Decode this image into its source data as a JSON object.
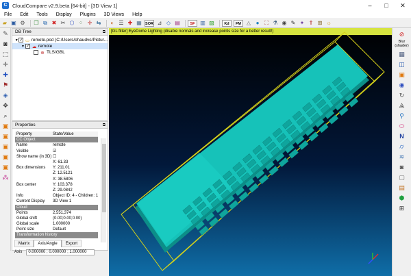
{
  "window": {
    "title": "CloudCompare v2.9.beta [64-bit] - [3D View 1]",
    "app_icon": "cc-logo-icon",
    "controls": [
      "–",
      "□",
      "✕"
    ]
  },
  "menu": [
    "File",
    "Edit",
    "Tools",
    "Display",
    "Plugins",
    "3D Views",
    "Help"
  ],
  "toolbar": {
    "icons": [
      "open-icon",
      "save-icon",
      "settings-icon",
      "clone-icon",
      "merge-icon",
      "delete-icon",
      "cut-icon",
      "segment-icon",
      "sample-icon",
      "translate-icon",
      "icp-icon",
      "compare-icon",
      "point-list-icon",
      "pick-icon",
      "octree-icon",
      "measure-icon",
      "plane-icon",
      "scalar-icon"
    ],
    "text_buttons": [
      "SOR",
      "SF",
      "Kd",
      "FM"
    ]
  },
  "db_tree": {
    "title": "DB Tree",
    "items": [
      {
        "label": "remote.pcd (C:/Users/chaudvc/Pictur...",
        "level": 0,
        "checked": true
      },
      {
        "label": "remote",
        "level": 1,
        "checked": true,
        "selected": true
      },
      {
        "label": "TLS/GBL",
        "level": 2,
        "checked": false
      }
    ]
  },
  "properties": {
    "title": "Properties",
    "header": {
      "k": "Property",
      "v": "State/Value"
    },
    "rows": [
      {
        "type": "section",
        "k": "CC Object",
        "v": ""
      },
      {
        "type": "row",
        "k": "Name",
        "v": "remote"
      },
      {
        "type": "check",
        "k": "Visible",
        "v": "☑"
      },
      {
        "type": "check",
        "k": "Show name (in 3D)",
        "v": "☐"
      },
      {
        "type": "multi",
        "k": "Box dimensions",
        "v": [
          "X: 61.33",
          "Y: 211.01",
          "Z: 12.5121"
        ]
      },
      {
        "type": "multi",
        "k": "Box center",
        "v": [
          "X: 38.5806",
          "Y: 103.378",
          "Z: 29.0842"
        ]
      },
      {
        "type": "row",
        "k": "Info",
        "v": "Object ID: 4 - Children: 1"
      },
      {
        "type": "row",
        "k": "Current Display",
        "v": "3D View 1"
      },
      {
        "type": "section",
        "k": "Cloud",
        "v": ""
      },
      {
        "type": "row",
        "k": "Points",
        "v": "2,551,374"
      },
      {
        "type": "row",
        "k": "Global shift",
        "v": "(0.00;0.00;0.00)"
      },
      {
        "type": "row",
        "k": "Global scale",
        "v": "1.000000"
      },
      {
        "type": "row",
        "k": "Point size",
        "v": "Default"
      },
      {
        "type": "section",
        "k": "Transformation history",
        "v": ""
      }
    ],
    "tabs": [
      "Matrix",
      "Axis/Angle",
      "Export"
    ],
    "axis": {
      "label": "Axis",
      "value": "0.000000 ; 0.000000 ; 1.000000"
    }
  },
  "view3d": {
    "gl_message": "[GL filter] EyeDome Lighting (disable normals and increase points size for a better result!)",
    "cloud_color": "#12c3ba",
    "bbox_color": "#d6d21a",
    "background_top": "#000000",
    "background_bottom": "#0f6ea8"
  },
  "right_panel": {
    "label": "Blur (shader)",
    "icons": [
      "no-shader-icon",
      "shader-grid-icon",
      "top-view-icon",
      "front-view-icon",
      "pivot-icon",
      "rotate-icon",
      "perspective-icon",
      "lightbulb-icon",
      "ellipse-icon",
      "north-icon",
      "cylinder-icon",
      "layers-icon",
      "camera-icon",
      "box-icon",
      "brick-icon",
      "zoom-icon",
      "ruler-icon"
    ]
  }
}
